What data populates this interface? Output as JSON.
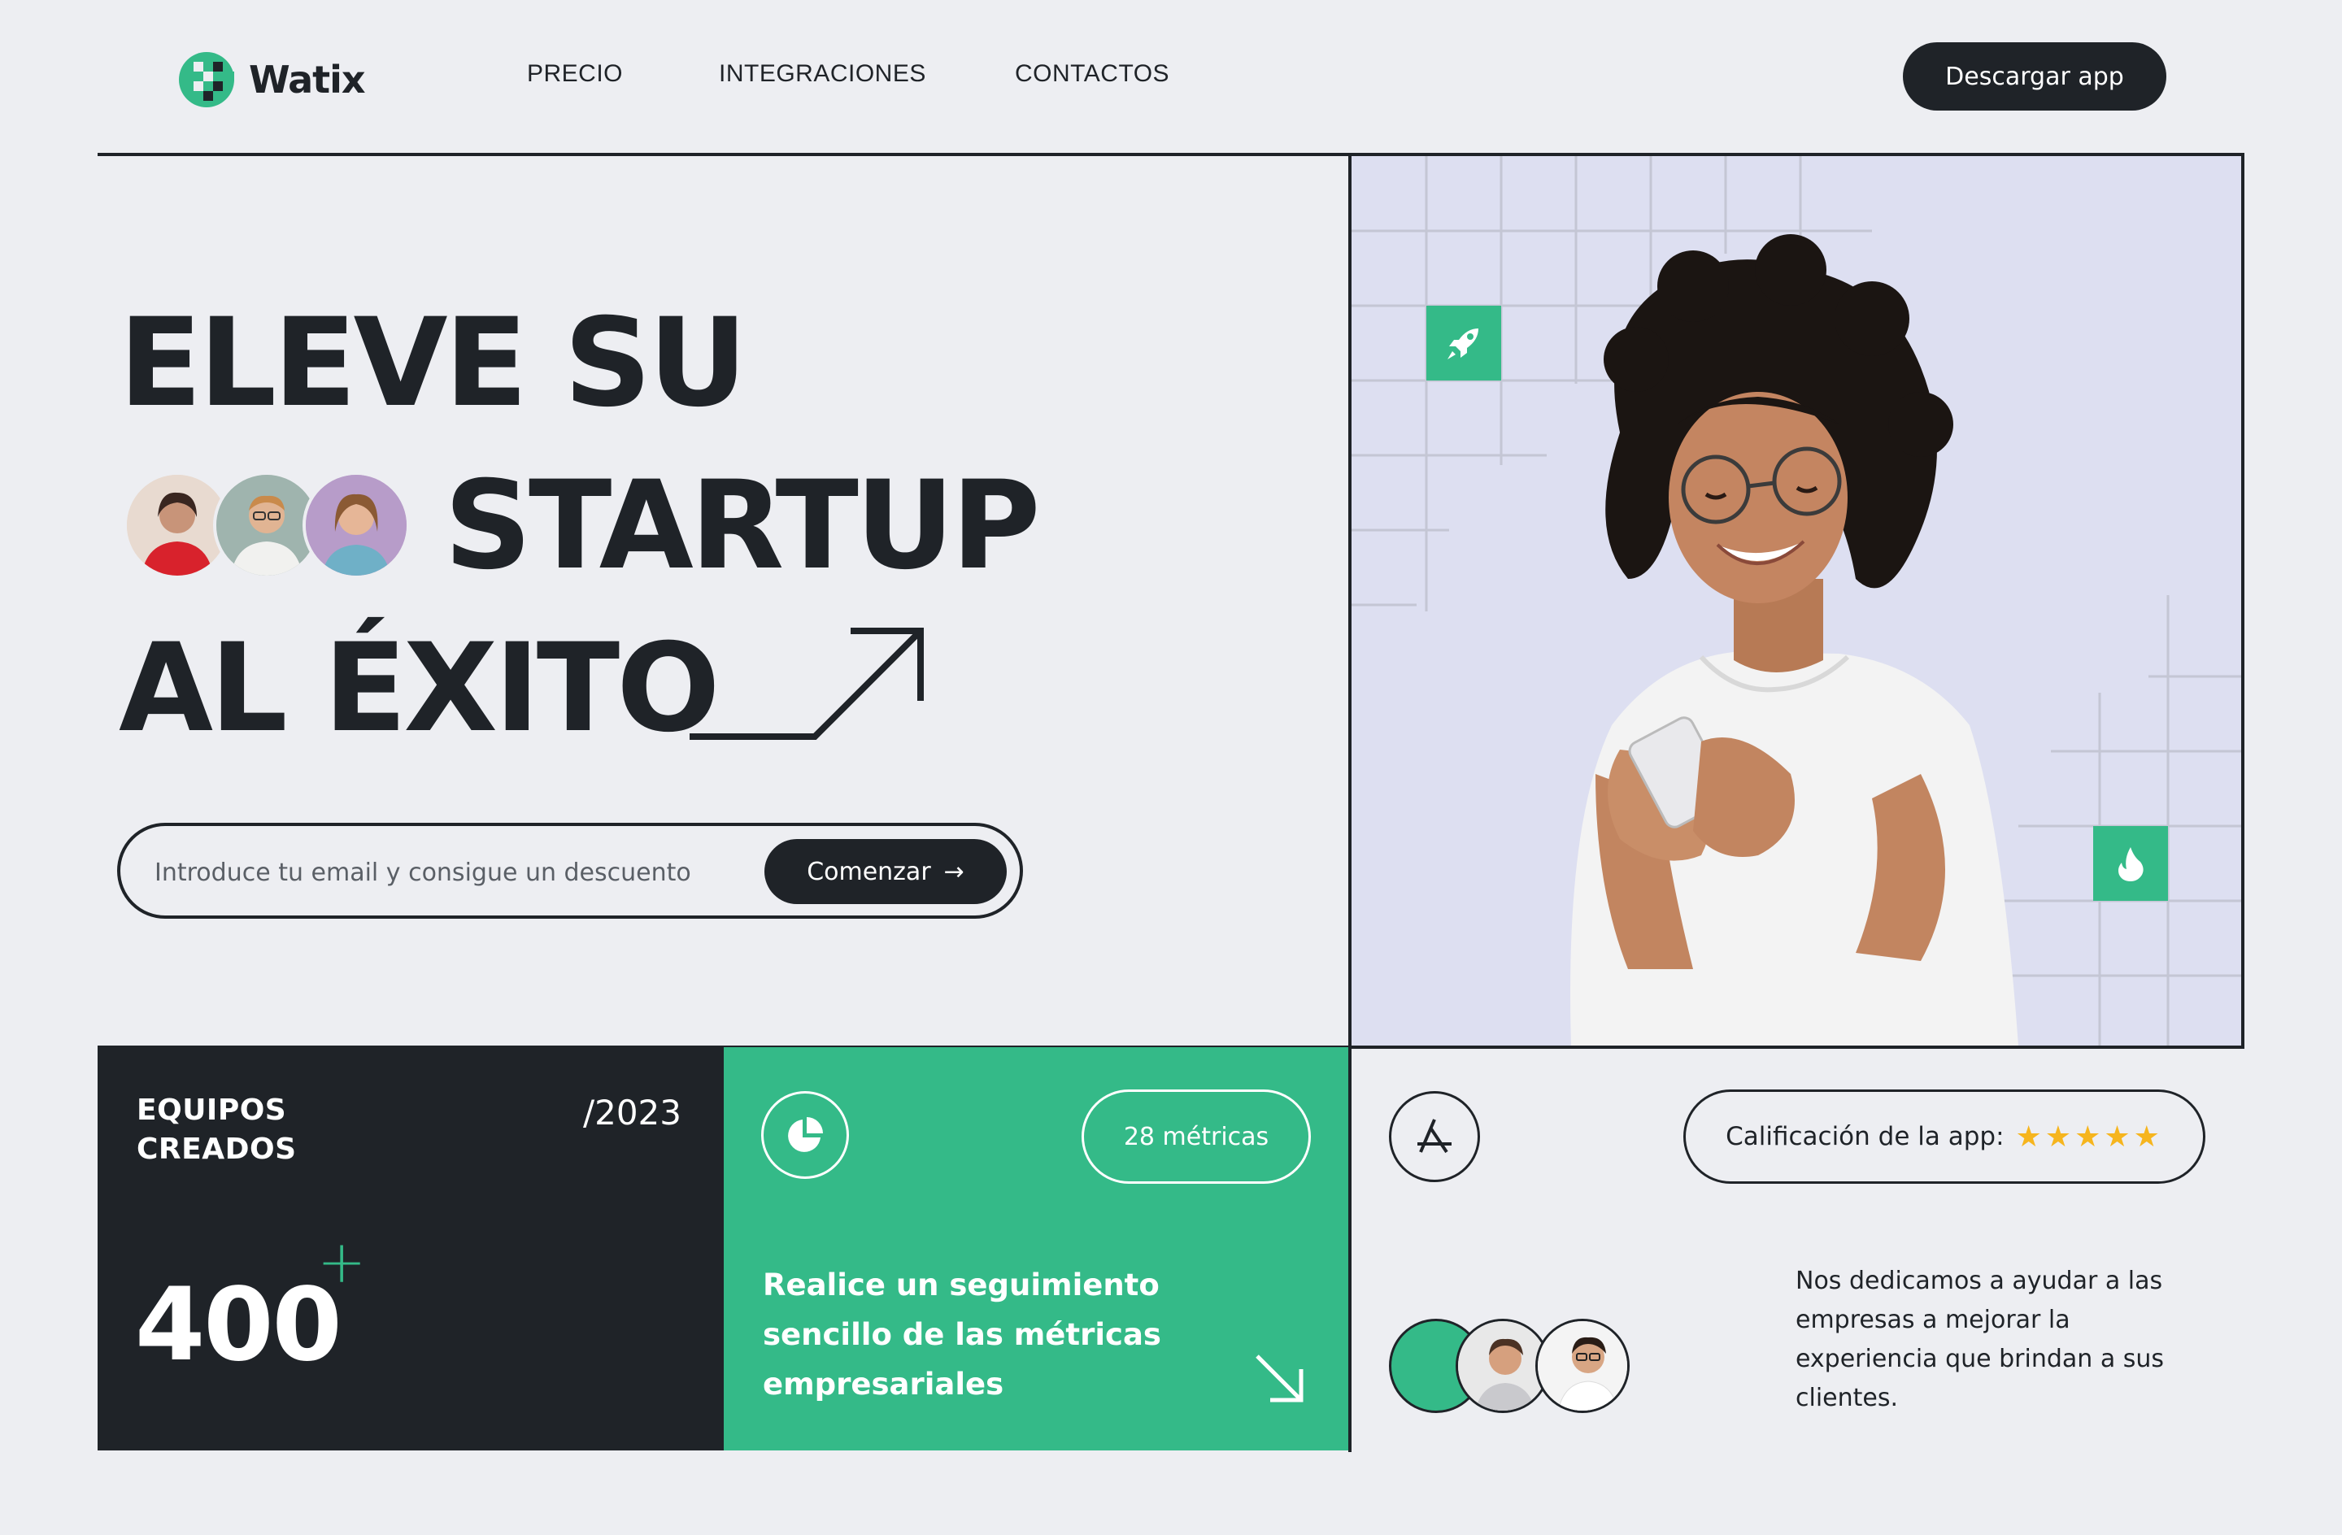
{
  "header": {
    "brand": "Watix",
    "nav": [
      "PRECIO",
      "INTEGRACIONES",
      "CONTACTOS"
    ],
    "download_label": "Descargar app"
  },
  "hero": {
    "line1": "ELEVE SU",
    "line2": "STARTUP",
    "line3": "AL ÉXITO",
    "email_placeholder": "Introduce tu email y consigue un descuento",
    "start_label": "Comenzar",
    "start_arrow": "→"
  },
  "stats": {
    "title_line1": "EQUIPOS",
    "title_line2": "CREADOS",
    "year": "/2023",
    "count": "400",
    "plus": "+"
  },
  "metrics_card": {
    "pill": "28 métricas",
    "text": "Realice un seguimiento sencillo de las métricas empresariales"
  },
  "rating": {
    "label": "Calificación de la app:",
    "stars": "★★★★★"
  },
  "mission": "Nos dedicamos a ayudar a las empresas a mejorar la experiencia que brindan a sus clientes.",
  "colors": {
    "background": "#edeef2",
    "dark": "#1f2328",
    "accent_green": "#34ba88",
    "photo_bg": "#dddff1",
    "star": "#f6b51e"
  },
  "icons": [
    "logo-icon",
    "arrow-right-icon",
    "growth-arrow-icon",
    "rocket-icon",
    "fire-icon",
    "pie-chart-icon",
    "arrow-down-right-icon",
    "app-store-icon",
    "star-icon"
  ]
}
